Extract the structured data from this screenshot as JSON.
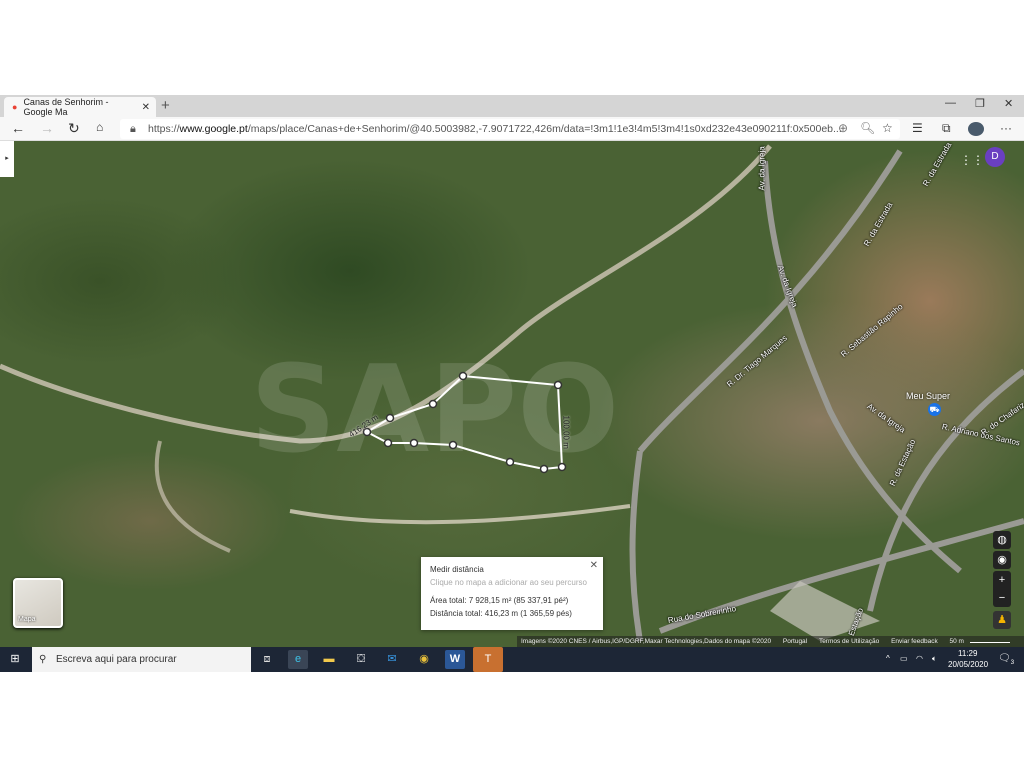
{
  "browser": {
    "tab_title": "Canas de Senhorim - Google Ma",
    "url_prefix": "https://",
    "url_host": "www.google.pt",
    "url_rest": "/maps/place/Canas+de+Senhorim/@40.5003982,-7.9071722,426m/data=!3m1!1e3!4m5!3m4!1s0xd232e43e090211f:0x500eb...",
    "profile_initial": "D"
  },
  "map": {
    "streets": [
      "Av. da Igreja",
      "Av. da Igreja",
      "Av. da Igreja",
      "R. da Estrada",
      "R. da Estrada",
      "R. Dr. Tiago Marques",
      "R. Sebastião Rapinho",
      "R. da Estação",
      "R. Adriano dos Santos",
      "R. do Chafariz",
      "Rua do Sobreirinho",
      "Estação"
    ],
    "poi": "Meu Super",
    "segment_labels": [
      "416,23 m",
      "100,00 m"
    ],
    "layer_label": "Mapa",
    "footer": {
      "imagery": "Imagens ©2020 CNES / Airbus,IGP/DGRF,Maxar Technologies,Dados do mapa ©2020",
      "country": "Portugal",
      "terms": "Termos de Utilização",
      "feedback": "Enviar feedback",
      "scale": "50 m"
    }
  },
  "measure": {
    "title": "Medir distância",
    "hint": "Clique no mapa a adicionar ao seu percurso",
    "area": "Área total: 7 928,15 m² (85 337,91 pé²)",
    "distance": "Distância total: 416,23 m (1 365,59 pés)"
  },
  "taskbar": {
    "search_placeholder": "Escreva aqui para procurar",
    "time": "11:29",
    "date": "20/05/2020",
    "notifications": "3"
  }
}
